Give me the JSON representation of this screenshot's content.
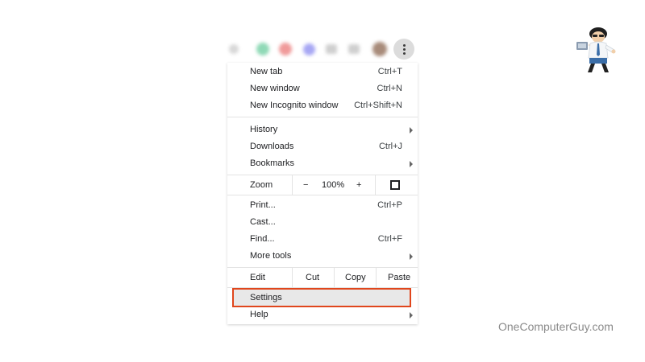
{
  "menu": {
    "items_group1": [
      {
        "label": "New tab",
        "shortcut": "Ctrl+T"
      },
      {
        "label": "New window",
        "shortcut": "Ctrl+N"
      },
      {
        "label": "New Incognito window",
        "shortcut": "Ctrl+Shift+N"
      }
    ],
    "items_group2": [
      {
        "label": "History",
        "shortcut": ""
      },
      {
        "label": "Downloads",
        "shortcut": "Ctrl+J"
      },
      {
        "label": "Bookmarks",
        "shortcut": ""
      }
    ],
    "zoom": {
      "label": "Zoom",
      "minus": "−",
      "value": "100%",
      "plus": "+"
    },
    "items_group3": [
      {
        "label": "Print...",
        "shortcut": "Ctrl+P"
      },
      {
        "label": "Cast...",
        "shortcut": ""
      },
      {
        "label": "Find...",
        "shortcut": "Ctrl+F"
      },
      {
        "label": "More tools",
        "shortcut": ""
      }
    ],
    "edit": {
      "label": "Edit",
      "cut": "Cut",
      "copy": "Copy",
      "paste": "Paste"
    },
    "settings": "Settings",
    "help": "Help"
  },
  "highlight_color": "#e0461c",
  "watermark": "OneComputerGuy.com"
}
